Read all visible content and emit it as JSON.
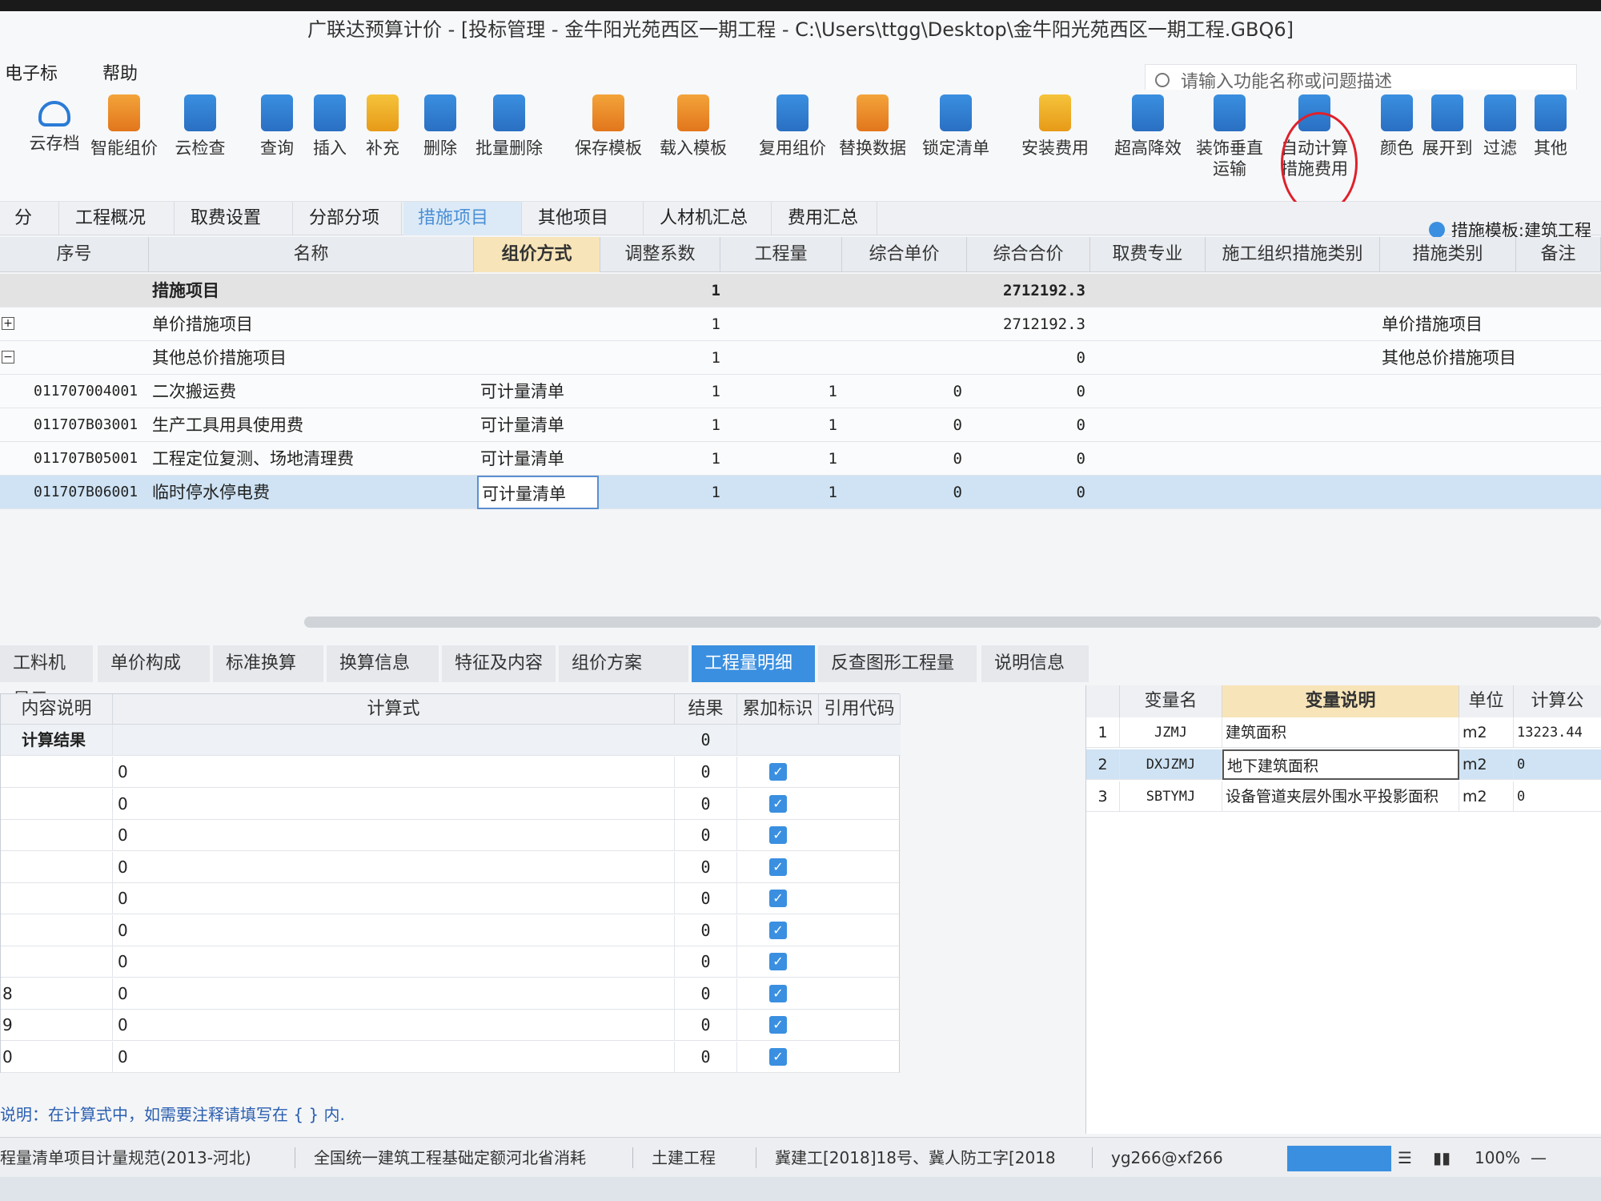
{
  "title": "广联达预算计价 - [投标管理 - 金牛阳光苑西区一期工程 - C:\\Users\\ttgg\\Desktop\\金牛阳光苑西区一期工程.GBQ6]",
  "menu": [
    "电子标",
    "帮助"
  ],
  "search_placeholder": "请输入功能名称或问题描述",
  "toolbar": [
    {
      "label": "云存档",
      "icon": "cloud-upload-icon"
    },
    {
      "label": "智能组价",
      "icon": "smart-price-icon"
    },
    {
      "label": "云检查",
      "icon": "cloud-check-icon"
    },
    {
      "label": "查询",
      "icon": "query-icon"
    },
    {
      "label": "插入",
      "icon": "insert-icon"
    },
    {
      "label": "补充",
      "icon": "supplement-icon"
    },
    {
      "label": "删除",
      "icon": "trash-icon"
    },
    {
      "label": "批量删除",
      "icon": "batch-delete-icon"
    },
    {
      "label": "保存模板",
      "icon": "save-template-icon"
    },
    {
      "label": "载入模板",
      "icon": "load-template-icon"
    },
    {
      "label": "复用组价",
      "icon": "reuse-icon"
    },
    {
      "label": "替换数据",
      "icon": "replace-icon"
    },
    {
      "label": "锁定清单",
      "icon": "lock-icon"
    },
    {
      "label": "安装费用",
      "icon": "install-cost-icon"
    },
    {
      "label": "超高降效",
      "icon": "height-icon"
    },
    {
      "label": "装饰垂直\n运输",
      "icon": "transport-icon"
    },
    {
      "label": "自动计算\n措施费用",
      "icon": "auto-calc-icon"
    },
    {
      "label": "颜色",
      "icon": "color-icon"
    },
    {
      "label": "展开到",
      "icon": "expand-icon"
    },
    {
      "label": "过滤",
      "icon": "filter-icon"
    },
    {
      "label": "其他",
      "icon": "more-icon"
    }
  ],
  "main_tabs": [
    "分析",
    "工程概况",
    "取费设置",
    "分部分项",
    "措施项目",
    "其他项目",
    "人材机汇总",
    "费用汇总"
  ],
  "active_main_tab": "措施项目",
  "template_label": "措施模板:建筑工程",
  "grid_headers": [
    "序号",
    "名称",
    "组价方式",
    "调整系数",
    "工程量",
    "综合单价",
    "综合合价",
    "取费专业",
    "施工组织措施类别",
    "措施类别",
    "备注"
  ],
  "grid_rows": [
    {
      "code": "",
      "name": "措施项目",
      "method": "",
      "coef": "1",
      "qty": "",
      "price": "",
      "total": "2712192.3",
      "cat": "",
      "type": "group"
    },
    {
      "code": "+",
      "name": "单价措施项目",
      "method": "",
      "coef": "1",
      "qty": "",
      "price": "",
      "total": "2712192.3",
      "cat": "单价措施项目",
      "type": "sub"
    },
    {
      "code": "−",
      "name": "其他总价措施项目",
      "method": "",
      "coef": "1",
      "qty": "",
      "price": "",
      "total": "0",
      "cat": "其他总价措施项目",
      "type": "sub"
    },
    {
      "code": "011707004001",
      "name": "二次搬运费",
      "method": "可计量清单",
      "coef": "1",
      "qty": "1",
      "price": "0",
      "total": "0",
      "cat": "",
      "type": "item"
    },
    {
      "code": "011707B03001",
      "name": "生产工具用具使用费",
      "method": "可计量清单",
      "coef": "1",
      "qty": "1",
      "price": "0",
      "total": "0",
      "cat": "",
      "type": "item"
    },
    {
      "code": "011707B05001",
      "name": "工程定位复测、场地清理费",
      "method": "可计量清单",
      "coef": "1",
      "qty": "1",
      "price": "0",
      "total": "0",
      "cat": "",
      "type": "item"
    },
    {
      "code": "011707B06001",
      "name": "临时停水停电费",
      "method": "可计量清单",
      "coef": "1",
      "qty": "1",
      "price": "0",
      "total": "0",
      "cat": "",
      "type": "selected"
    }
  ],
  "bottom_tabs": [
    "工料机显示",
    "单价构成",
    "标准换算",
    "换算信息",
    "特征及内容",
    "组价方案",
    "工程量明细",
    "反查图形工程量",
    "说明信息"
  ],
  "active_bottom_tab": "工程量明细",
  "left_headers": [
    "内容说明",
    "计算式",
    "结果",
    "累加标识",
    "引用代码"
  ],
  "left_summary": {
    "label": "计算结果",
    "result": "0"
  },
  "left_rows": [
    {
      "idx": "",
      "formula": "0",
      "result": "0"
    },
    {
      "idx": "",
      "formula": "0",
      "result": "0"
    },
    {
      "idx": "",
      "formula": "0",
      "result": "0"
    },
    {
      "idx": "",
      "formula": "0",
      "result": "0"
    },
    {
      "idx": "",
      "formula": "0",
      "result": "0"
    },
    {
      "idx": "",
      "formula": "0",
      "result": "0"
    },
    {
      "idx": "",
      "formula": "0",
      "result": "0"
    },
    {
      "idx": "8",
      "formula": "0",
      "result": "0"
    },
    {
      "idx": "9",
      "formula": "0",
      "result": "0"
    },
    {
      "idx": "0",
      "formula": "0",
      "result": "0"
    }
  ],
  "right_headers": [
    "",
    "变量名",
    "变量说明",
    "单位",
    "计算公"
  ],
  "right_rows": [
    {
      "n": "1",
      "var": "JZMJ",
      "desc": "建筑面积",
      "unit": "m2",
      "val": "13223.44"
    },
    {
      "n": "2",
      "var": "DXJZMJ",
      "desc": "地下建筑面积",
      "unit": "m2",
      "val": "0"
    },
    {
      "n": "3",
      "var": "SBTYMJ",
      "desc": "设备管道夹层外围水平投影面积",
      "unit": "m2",
      "val": "0"
    }
  ],
  "note": "说明：在计算式中，如需要注释请填写在 { } 内.",
  "status": [
    "程量清单项目计量规范(2013-河北)",
    "全国统一建筑工程基础定额河北省消耗",
    "土建工程",
    "冀建工[2018]18号、冀人防工字[2018",
    "yg266@xf266"
  ],
  "zoom": "100%",
  "colors": {
    "accent": "#3a8fe0",
    "selected_row": "#cfe3f4",
    "highlight_header": "#f7e4b8",
    "annotation_circle": "#e0202a"
  }
}
